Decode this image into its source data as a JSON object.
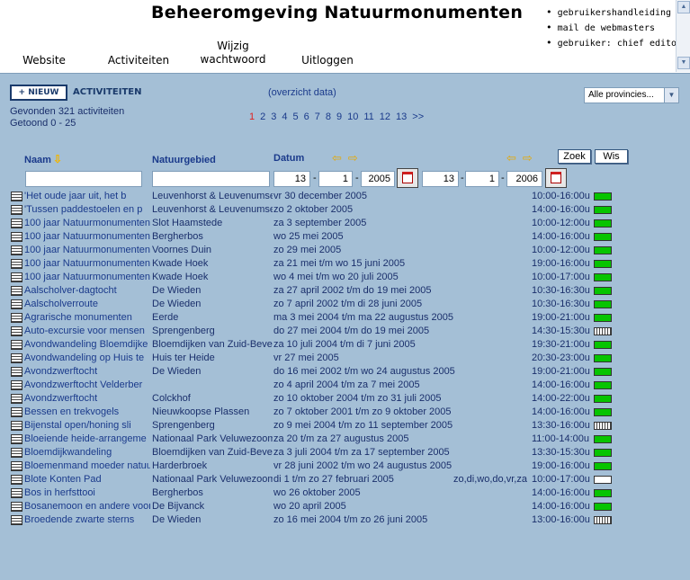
{
  "header": {
    "title": "Beheeromgeving Natuurmonumenten",
    "nav": [
      "Website",
      "Activiteiten",
      "Wijzig wachtwoord",
      "Uitloggen"
    ],
    "user_links": [
      "gebruikershandleiding",
      "mail de webmasters",
      "gebruiker: chief editor"
    ]
  },
  "toolbar": {
    "new_button": "+ NIEUW",
    "section_title": "ACTIVITEITEN",
    "overview_link": "(overzicht data)",
    "province_select": "Alle provincies..."
  },
  "stats": {
    "found": "Gevonden 321 activiteiten",
    "shown": "Getoond 0 - 25"
  },
  "pager": {
    "pages": [
      "1",
      "2",
      "3",
      "4",
      "5",
      "6",
      "7",
      "8",
      "9",
      "10",
      "11",
      "12",
      "13",
      ">>"
    ],
    "current": "1"
  },
  "columns": {
    "naam": "Naam",
    "gebied": "Natuurgebied",
    "datum": "Datum"
  },
  "filters": {
    "search_button": "Zoek",
    "clear_button": "Wis",
    "from_day": "13",
    "from_month": "1",
    "from_year": "2005",
    "to_day": "13",
    "to_month": "1",
    "to_year": "2006"
  },
  "rows": [
    {
      "naam": "'Het oude jaar uit, het b",
      "gebied": "Leuvenhorst & Leuvenumse",
      "datum": "vr 30 december 2005",
      "days": "",
      "tijd": "10:00-16:00u",
      "flag": "green"
    },
    {
      "naam": "'Tussen paddestoelen en p",
      "gebied": "Leuvenhorst & Leuvenumse",
      "datum": "zo 2 oktober 2005",
      "days": "",
      "tijd": "14:00-16:00u",
      "flag": "green"
    },
    {
      "naam": "100 jaar Natuurmonumenten",
      "gebied": "Slot Haamstede",
      "datum": "za 3 september 2005",
      "days": "",
      "tijd": "10:00-12:00u",
      "flag": "green"
    },
    {
      "naam": "100 jaar Natuurmonumenten",
      "gebied": "Bergherbos",
      "datum": "wo 25 mei 2005",
      "days": "",
      "tijd": "14:00-16:00u",
      "flag": "green"
    },
    {
      "naam": "100 jaar Natuurmonumenten",
      "gebied": "Voornes Duin",
      "datum": "zo 29 mei 2005",
      "days": "",
      "tijd": "10:00-12:00u",
      "flag": "green"
    },
    {
      "naam": "100 jaar Natuurmonumenten",
      "gebied": "Kwade Hoek",
      "datum": "za 21 mei t/m wo 15 juni 2005",
      "days": "",
      "tijd": "19:00-16:00u",
      "flag": "green"
    },
    {
      "naam": "100 jaar Natuurmonumenten",
      "gebied": "Kwade Hoek",
      "datum": "wo 4 mei t/m wo 20 juli 2005",
      "days": "",
      "tijd": "10:00-17:00u",
      "flag": "green"
    },
    {
      "naam": "Aalscholver-dagtocht",
      "gebied": "De Wieden",
      "datum": "za 27 april 2002 t/m do 19 mei 2005",
      "days": "",
      "tijd": "10:30-16:30u",
      "flag": "green"
    },
    {
      "naam": "Aalscholverroute",
      "gebied": "De Wieden",
      "datum": "zo 7 april 2002 t/m di 28 juni 2005",
      "days": "",
      "tijd": "10:30-16:30u",
      "flag": "green"
    },
    {
      "naam": "Agrarische monumenten",
      "gebied": "Eerde",
      "datum": "ma 3 mei 2004 t/m ma 22 augustus 2005",
      "days": "",
      "tijd": "19:00-21:00u",
      "flag": "green"
    },
    {
      "naam": "Auto-excursie voor mensen",
      "gebied": "Sprengenberg",
      "datum": "do 27 mei 2004 t/m do 19 mei 2005",
      "days": "",
      "tijd": "14:30-15:30u",
      "flag": "pattern"
    },
    {
      "naam": "Avondwandeling Bloemdijke",
      "gebied": "Bloemdijken van Zuid-Beve",
      "datum": "za 10 juli 2004 t/m di 7 juni 2005",
      "days": "",
      "tijd": "19:30-21:00u",
      "flag": "green"
    },
    {
      "naam": "Avondwandeling op Huis te",
      "gebied": "Huis ter Heide",
      "datum": "vr 27 mei 2005",
      "days": "",
      "tijd": "20:30-23:00u",
      "flag": "green"
    },
    {
      "naam": "Avondzwerftocht",
      "gebied": "De Wieden",
      "datum": "do 16 mei 2002 t/m wo 24 augustus 2005",
      "days": "",
      "tijd": "19:00-21:00u",
      "flag": "green"
    },
    {
      "naam": "Avondzwerftocht Velderber",
      "gebied": "",
      "datum": "zo 4 april 2004 t/m za 7 mei 2005",
      "days": "",
      "tijd": "14:00-16:00u",
      "flag": "green"
    },
    {
      "naam": "Avondzwerftocht",
      "gebied": "Colckhof",
      "datum": "zo 10 oktober 2004 t/m zo 31 juli 2005",
      "days": "",
      "tijd": "14:00-22:00u",
      "flag": "green"
    },
    {
      "naam": "Bessen en trekvogels",
      "gebied": "Nieuwkoopse Plassen",
      "datum": "zo 7 oktober 2001 t/m zo 9 oktober 2005",
      "days": "",
      "tijd": "14:00-16:00u",
      "flag": "green"
    },
    {
      "naam": "Bijenstal open/honing sli",
      "gebied": "Sprengenberg",
      "datum": "zo 9 mei 2004 t/m zo 11 september 2005",
      "days": "",
      "tijd": "13:30-16:00u",
      "flag": "pattern"
    },
    {
      "naam": "Bloeiende heide-arrangeme",
      "gebied": "Nationaal Park Veluwezoom",
      "datum": "za 20 t/m za 27 augustus 2005",
      "days": "",
      "tijd": "11:00-14:00u",
      "flag": "green"
    },
    {
      "naam": "Bloemdijkwandeling",
      "gebied": "Bloemdijken van Zuid-Beve",
      "datum": "za 3 juli 2004 t/m za 17 september 2005",
      "days": "",
      "tijd": "13:30-15:30u",
      "flag": "green"
    },
    {
      "naam": "Bloemenmand moeder natuur",
      "gebied": "Harderbroek",
      "datum": "vr 28 juni 2002 t/m wo 24 augustus 2005",
      "days": "",
      "tijd": "19:00-16:00u",
      "flag": "green"
    },
    {
      "naam": "Blote Konten Pad",
      "gebied": "Nationaal Park Veluwezoom",
      "datum": "di 1 t/m zo 27 februari 2005",
      "days": "zo,di,wo,do,vr,za",
      "tijd": "10:00-17:00u",
      "flag": "white"
    },
    {
      "naam": "Bos in herfsttooi",
      "gebied": "Bergherbos",
      "datum": "wo 26 oktober 2005",
      "days": "",
      "tijd": "14:00-16:00u",
      "flag": "green"
    },
    {
      "naam": "Bosanemoon en andere voor",
      "gebied": "De Bijvanck",
      "datum": "wo 20 april 2005",
      "days": "",
      "tijd": "14:00-16:00u",
      "flag": "green"
    },
    {
      "naam": "Broedende zwarte sterns",
      "gebied": "De Wieden",
      "datum": "zo 16 mei 2004 t/m zo 26 juni 2005",
      "days": "",
      "tijd": "13:00-16:00u",
      "flag": "pattern"
    }
  ]
}
